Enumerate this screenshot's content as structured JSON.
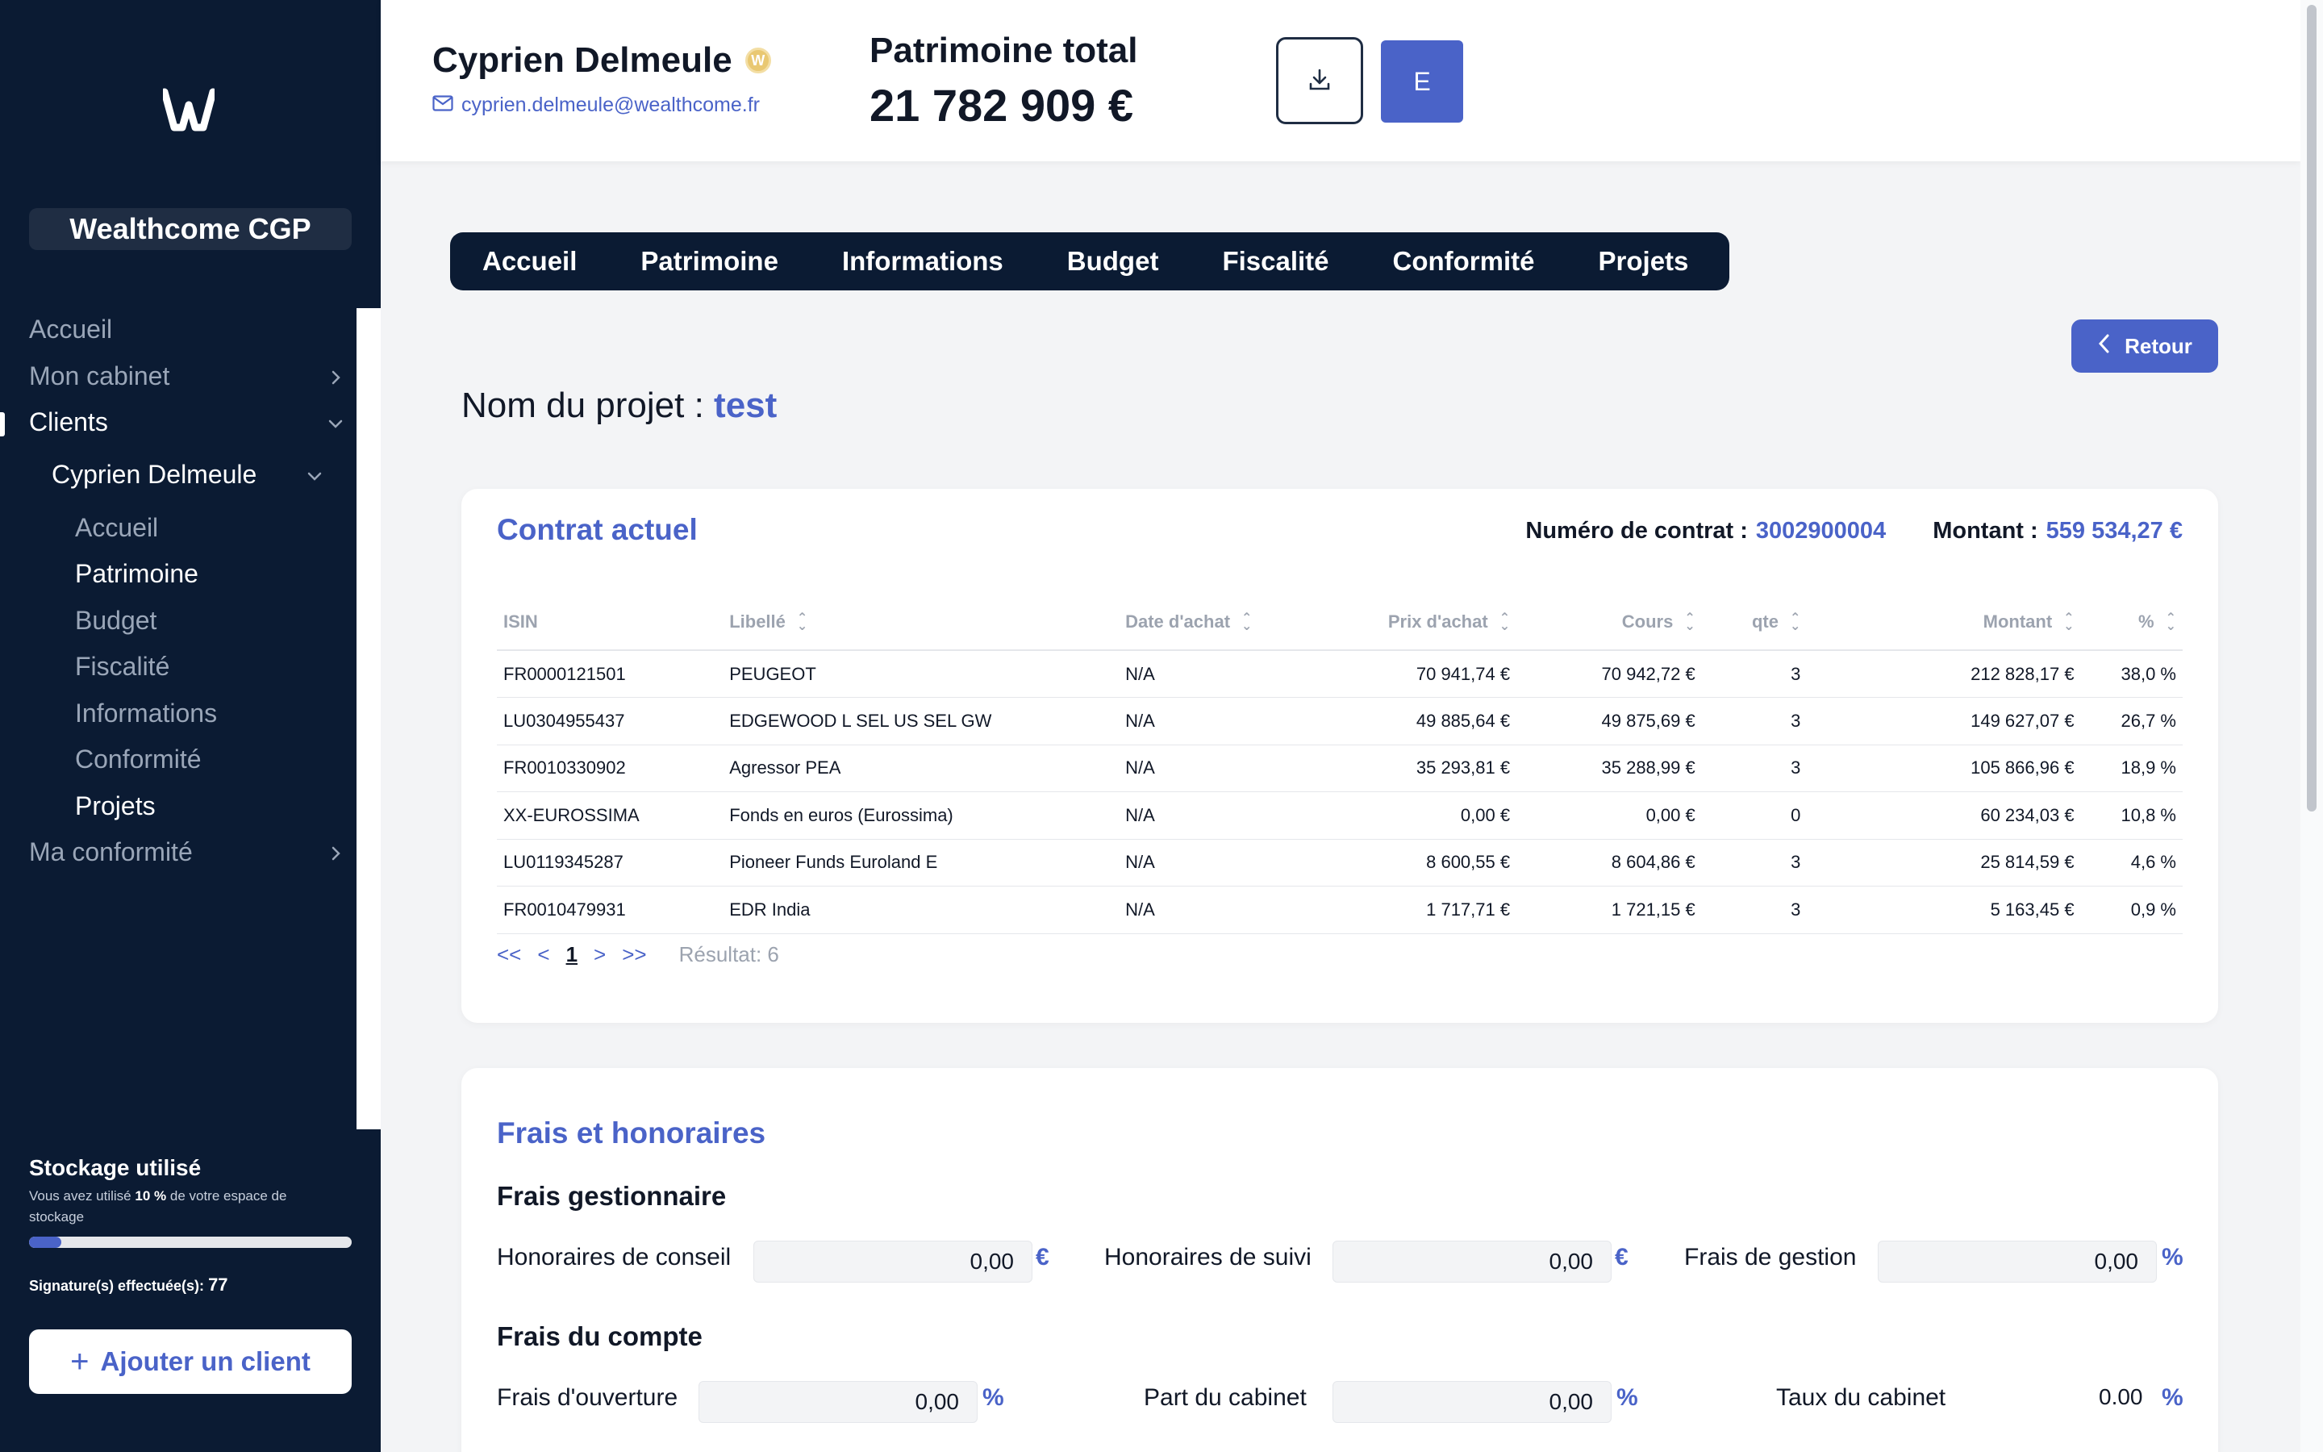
{
  "sidebar": {
    "brand": "Wealthcome CGP",
    "items": [
      {
        "label": "Accueil"
      },
      {
        "label": "Mon cabinet"
      },
      {
        "label": "Clients"
      },
      {
        "label": "Cyprien Delmeule"
      },
      {
        "label": "Accueil"
      },
      {
        "label": "Patrimoine"
      },
      {
        "label": "Budget"
      },
      {
        "label": "Fiscalité"
      },
      {
        "label": "Informations"
      },
      {
        "label": "Conformité"
      },
      {
        "label": "Projets"
      },
      {
        "label": "Ma conformité"
      }
    ],
    "storage": {
      "title": "Stockage utilisé",
      "desc_prefix": "Vous avez utilisé",
      "percent": "10 %",
      "desc_suffix": "de votre espace de stockage",
      "used_fraction": 0.1,
      "signatures_label": "Signature(s) effectuée(s):",
      "signatures_count": "77"
    },
    "add_client_label": "Ajouter un client"
  },
  "header": {
    "client_name": "Cyprien Delmeule",
    "client_email": "cyprien.delmeule@wealthcome.fr",
    "patrimoine_label": "Patrimoine total",
    "patrimoine_value": "21 782 909 €",
    "avatar_initial": "E"
  },
  "tabs": [
    "Accueil",
    "Patrimoine",
    "Informations",
    "Budget",
    "Fiscalité",
    "Conformité",
    "Projets"
  ],
  "retour_label": "Retour",
  "project": {
    "label": "Nom du projet :",
    "name": "test"
  },
  "contract": {
    "title": "Contrat actuel",
    "number_label": "Numéro de contrat :",
    "number": "3002900004",
    "amount_label": "Montant :",
    "amount": "559 534,27 €",
    "columns": [
      "ISIN",
      "Libellé",
      "Date d'achat",
      "Prix d'achat",
      "Cours",
      "qte",
      "Montant",
      "%"
    ],
    "rows": [
      [
        "FR0000121501",
        "PEUGEOT",
        "N/A",
        "70 941,74 €",
        "70 942,72 €",
        "3",
        "212 828,17 €",
        "38,0 %"
      ],
      [
        "LU0304955437",
        "EDGEWOOD L SEL US SEL GW",
        "N/A",
        "49 885,64 €",
        "49 875,69 €",
        "3",
        "149 627,07 €",
        "26,7 %"
      ],
      [
        "FR0010330902",
        "Agressor PEA",
        "N/A",
        "35 293,81 €",
        "35 288,99 €",
        "3",
        "105 866,96 €",
        "18,9 %"
      ],
      [
        "XX-EUROSSIMA",
        "Fonds en euros (Eurossima)",
        "N/A",
        "0,00 €",
        "0,00 €",
        "0",
        "60 234,03 €",
        "10,8 %"
      ],
      [
        "LU0119345287",
        "Pioneer Funds Euroland E",
        "N/A",
        "8 600,55 €",
        "8 604,86 €",
        "3",
        "25 814,59 €",
        "4,6 %"
      ],
      [
        "FR0010479931",
        "EDR India",
        "N/A",
        "1 717,71 €",
        "1 721,15 €",
        "3",
        "5 163,45 €",
        "0,9 %"
      ]
    ],
    "pager": {
      "first": "<<",
      "prev": "<",
      "current": "1",
      "next": ">",
      "last": ">>",
      "result": "Résultat: 6"
    }
  },
  "fees": {
    "title": "Frais et honoraires",
    "gestionnaire_title": "Frais gestionnaire",
    "honoraires_conseil_label": "Honoraires de conseil",
    "honoraires_conseil_value": "0,00",
    "honoraires_suivi_label": "Honoraires de suivi",
    "honoraires_suivi_value": "0,00",
    "frais_gestion_label": "Frais de gestion",
    "frais_gestion_value": "0,00",
    "compte_title": "Frais du compte",
    "frais_ouverture_label": "Frais d'ouverture",
    "frais_ouverture_value": "0,00",
    "part_cabinet_label": "Part du cabinet",
    "part_cabinet_value": "0,00",
    "taux_cabinet_label": "Taux du cabinet",
    "taux_cabinet_value": "0.00",
    "euro_unit": "€",
    "percent_unit": "%"
  }
}
